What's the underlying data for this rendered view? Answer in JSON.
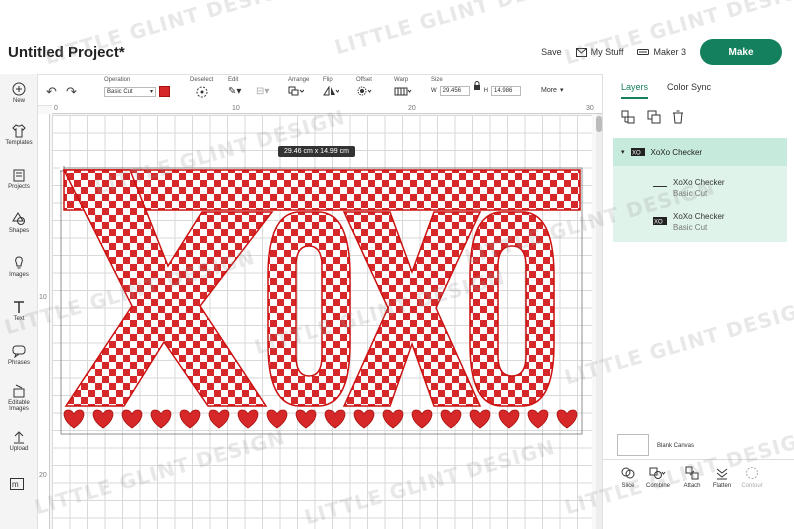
{
  "project": {
    "title": "Untitled Project*"
  },
  "top": {
    "save_label": "Save",
    "mystuff_label": "My Stuff",
    "machine_label": "Maker 3",
    "make_label": "Make"
  },
  "toolbar": {
    "operation_label": "Operation",
    "operation_value": "Basic Cut",
    "deselect_label": "Deselect",
    "edit_label": "Edit",
    "arrange_label": "Arrange",
    "flip_label": "Flip",
    "offset_label": "Offset",
    "warp_label": "Warp",
    "size_label": "Size",
    "w_label": "W",
    "w_value": "29.456",
    "h_label": "H",
    "h_value": "14.986",
    "more_label": "More"
  },
  "leftrail": [
    {
      "label": "New",
      "icon": "plus-circle-icon"
    },
    {
      "label": "Templates",
      "icon": "shirt-icon"
    },
    {
      "label": "Projects",
      "icon": "folder-icon"
    },
    {
      "label": "Shapes",
      "icon": "shapes-icon"
    },
    {
      "label": "Images",
      "icon": "bulb-icon"
    },
    {
      "label": "Text",
      "icon": "text-icon"
    },
    {
      "label": "Phrases",
      "icon": "speech-icon"
    },
    {
      "label": "Editable Images",
      "icon": "editable-icon"
    },
    {
      "label": "Upload",
      "icon": "upload-icon"
    }
  ],
  "canvas": {
    "dimension_badge": "29.46  cm x 14.99  cm",
    "ruler_top": [
      "0",
      "10",
      "20",
      "30"
    ],
    "ruler_left": [
      "10",
      "20"
    ],
    "design_text": "XOXO"
  },
  "panel": {
    "tabs": [
      "Layers",
      "Color Sync"
    ],
    "group_name": "XoXo Checker",
    "layers": [
      {
        "name": "XoXo Checker",
        "op": "Basic Cut"
      },
      {
        "name": "XoXo Checker",
        "op": "Basic Cut"
      }
    ],
    "blank_canvas_label": "Blank Canvas",
    "bottom_tools": [
      "Slice",
      "Combine",
      "Attach",
      "Flatten",
      "Contour"
    ]
  },
  "watermark": "LITTLE GLINT DESIGN",
  "colors": {
    "accent": "#15805e",
    "design_red": "#d62828"
  }
}
